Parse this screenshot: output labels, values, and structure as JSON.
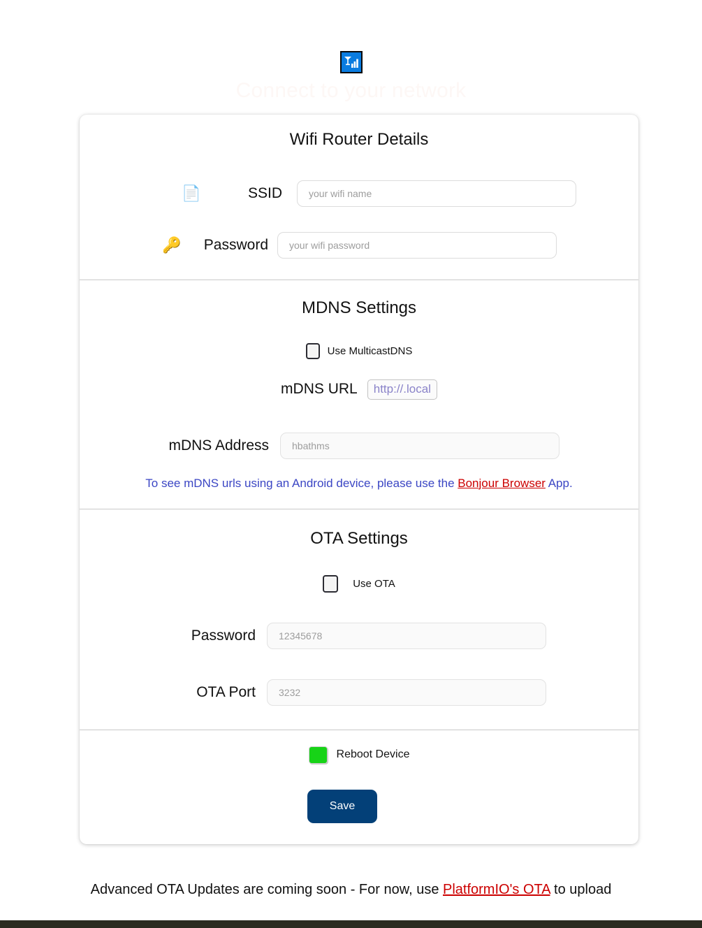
{
  "header": {
    "icon": "signal-bars-icon",
    "title": "Connect to your network",
    "title_color": "#fdf7f5"
  },
  "wifi_section": {
    "title": "Wifi Router Details",
    "ssid": {
      "icon": "document-icon",
      "icon_glyph": "📄",
      "label": "SSID",
      "value": "",
      "placeholder": "your wifi name"
    },
    "password": {
      "icon": "key-icon",
      "icon_glyph": "🔑",
      "label": "Password",
      "value": "",
      "placeholder": "your wifi password"
    }
  },
  "mdns_section": {
    "title": "MDNS Settings",
    "use_multicast": {
      "label": "Use MulticastDNS",
      "checked": false
    },
    "url": {
      "label": "mDNS URL",
      "value": "http://.local",
      "color": "#8a83c9"
    },
    "address": {
      "label": "mDNS Address",
      "value": "",
      "placeholder": "hbathms"
    },
    "note": {
      "before": "To see mDNS urls using an Android device, please use the ",
      "link": "Bonjour Browser",
      "after": " App.",
      "color": "#3b46c4",
      "link_color": "#cc0000"
    }
  },
  "ota_section": {
    "title": "OTA Settings",
    "use_ota": {
      "label": "Use OTA",
      "checked": false
    },
    "password": {
      "label": "Password",
      "value": "",
      "placeholder": "12345678"
    },
    "port": {
      "label": "OTA Port",
      "value": "",
      "placeholder": "3232"
    }
  },
  "footer_section": {
    "reboot": {
      "label": "Reboot Device",
      "checked": true,
      "color": "#17d317"
    },
    "save_label": "Save",
    "save_color": "#034078"
  },
  "page_footer": {
    "before": "Advanced OTA Updates are coming soon - For now, use ",
    "link": "PlatformIO's OTA",
    "after": " to upload",
    "link_color": "#cc0000"
  }
}
